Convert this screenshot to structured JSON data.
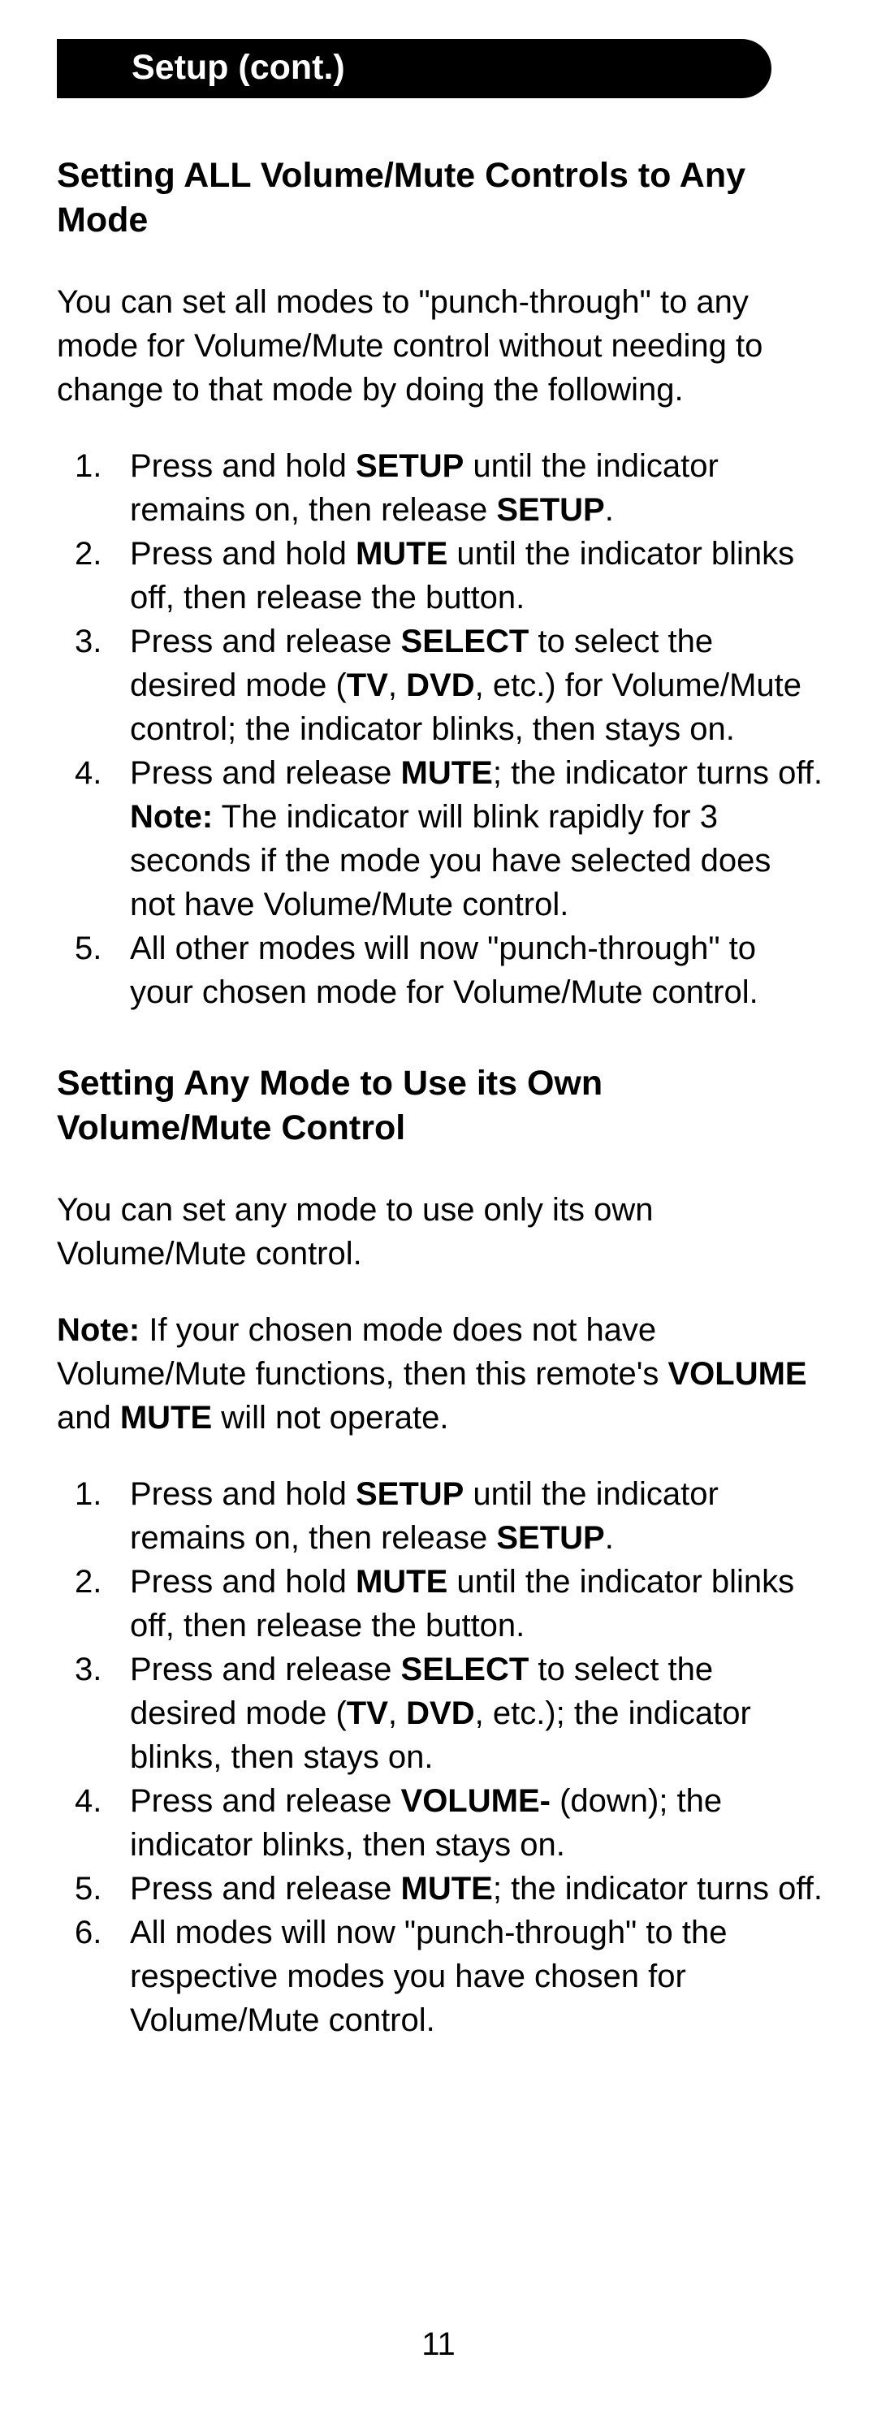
{
  "tab_title": "Setup (cont.)",
  "section1": {
    "heading": "Setting ALL Volume/Mute Controls to Any Mode",
    "intro": "You can set all modes to \"punch-through\" to any mode for Volume/Mute control without needing to change to that mode by doing the following.",
    "steps": [
      {
        "pre": "Press and hold ",
        "b1": "SETUP",
        "mid": " until the indicator remains on, then release ",
        "b2": "SETUP",
        "post": "."
      },
      {
        "pre": "Press and hold ",
        "b1": "MUTE",
        "mid": " until the indicator blinks off, then release the button.",
        "b2": "",
        "post": ""
      },
      {
        "pre": "Press and release ",
        "b1": "SELECT",
        "mid": " to select the desired mode (",
        "b2": "TV",
        "post": ", ",
        "b3": "DVD",
        "post2": ", etc.) for Volume/Mute control; the indicator blinks, then stays on."
      },
      {
        "pre": "Press and release ",
        "b1": "MUTE",
        "mid": "; the indicator turns off. ",
        "b2": "Note:",
        "post": " The indicator will blink rapidly for 3 seconds if the mode you have selected does not have Volume/Mute control."
      },
      {
        "pre": "All other modes will now \"punch-through\" to your chosen mode for Volume/Mute control.",
        "b1": "",
        "mid": "",
        "b2": "",
        "post": ""
      }
    ]
  },
  "section2": {
    "heading": "Setting Any Mode to Use its Own Volume/Mute Control",
    "intro": "You can set any mode to use only its own Volume/Mute control.",
    "note_label": "Note:",
    "note_pre": " If your chosen mode does not have Volume/Mute functions, then this remote's ",
    "note_b1": "VOLUME",
    "note_mid": " and ",
    "note_b2": "MUTE",
    "note_post": " will not operate.",
    "steps": [
      {
        "pre": "Press and hold ",
        "b1": "SETUP",
        "mid": " until the indicator remains on, then release ",
        "b2": "SETUP",
        "post": "."
      },
      {
        "pre": "Press and hold ",
        "b1": "MUTE",
        "mid": " until the indicator blinks off, then release the button.",
        "b2": "",
        "post": ""
      },
      {
        "pre": "Press and release ",
        "b1": "SELECT",
        "mid": " to select the desired mode (",
        "b2": "TV",
        "post": ", ",
        "b3": "DVD",
        "post2": ", etc.); the indicator blinks, then stays on."
      },
      {
        "pre": "Press and release ",
        "b1": "VOLUME-",
        "mid": " (down); the indicator blinks, then stays on.",
        "b2": "",
        "post": ""
      },
      {
        "pre": "Press and release ",
        "b1": "MUTE",
        "mid": "; the indicator turns off.",
        "b2": "",
        "post": ""
      },
      {
        "pre": "All modes will now \"punch-through\" to the respective modes you have chosen for Volume/Mute control.",
        "b1": "",
        "mid": "",
        "b2": "",
        "post": ""
      }
    ]
  },
  "page_number": "11"
}
